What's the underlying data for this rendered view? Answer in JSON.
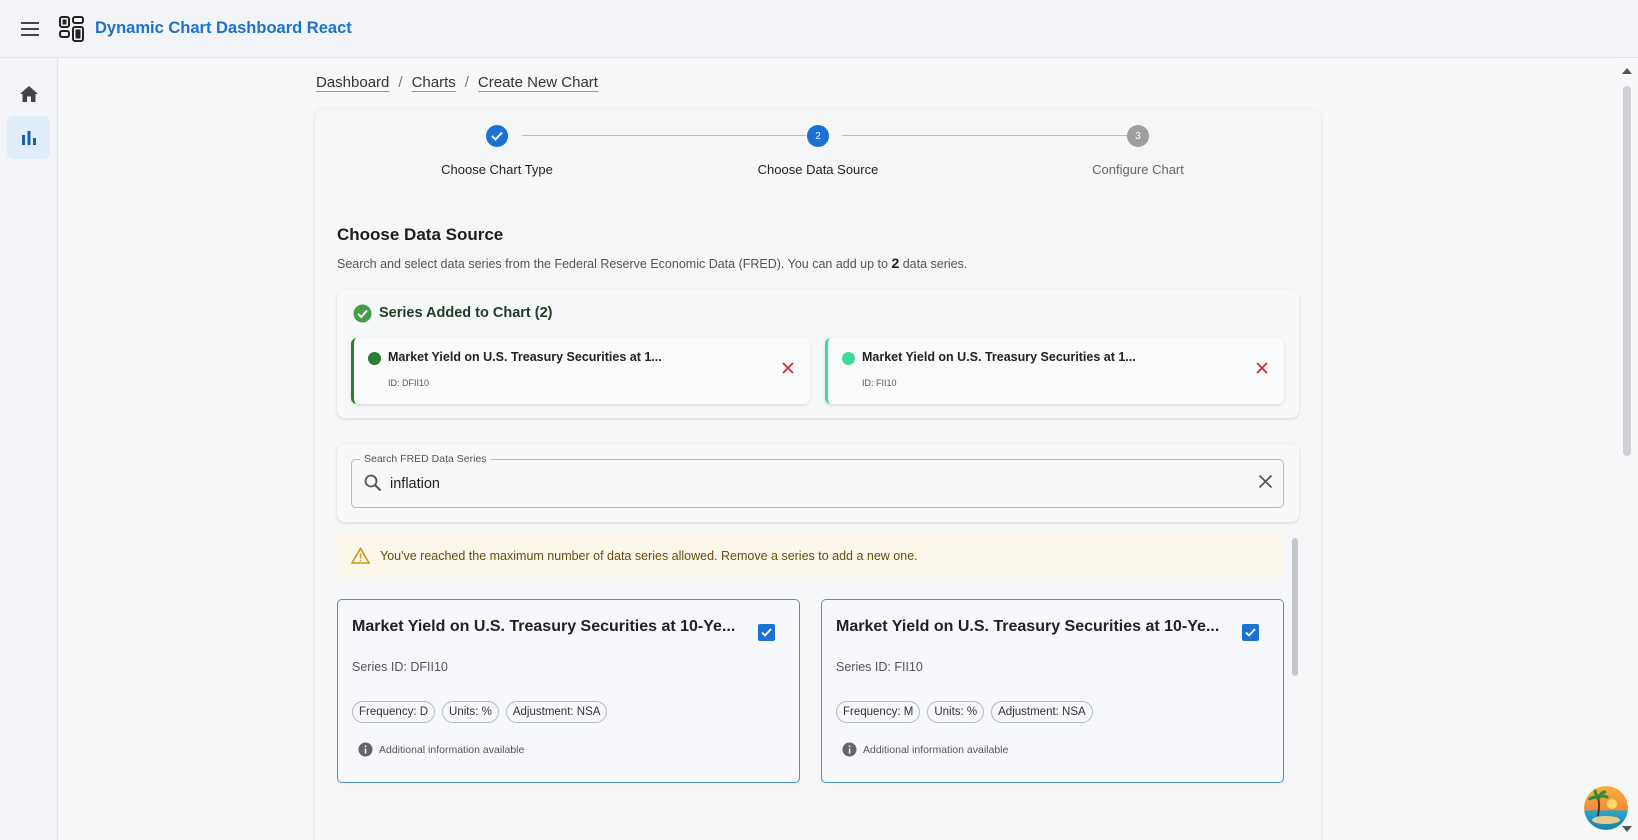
{
  "app": {
    "title": "Dynamic Chart Dashboard React"
  },
  "breadcrumb": [
    "Dashboard",
    "Charts",
    "Create New Chart"
  ],
  "steps": [
    {
      "label": "Choose Chart Type",
      "state": "completed"
    },
    {
      "label": "Choose Data Source",
      "number": "2",
      "state": "active"
    },
    {
      "label": "Configure Chart",
      "number": "3",
      "state": "pending"
    }
  ],
  "section": {
    "title": "Choose Data Source",
    "desc_prefix": "Search and select data series from the Federal Reserve Economic Data (FRED). You can add up to ",
    "desc_max": "2",
    "desc_suffix": " data series."
  },
  "added": {
    "title": "Series Added to Chart (2)",
    "items": [
      {
        "name": "Market Yield on U.S. Treasury Securities at 1...",
        "id": "ID: DFII10",
        "color": "#2e7d32"
      },
      {
        "name": "Market Yield on U.S. Treasury Securities at 1...",
        "id": "ID: FII10",
        "color": "#3ddc97"
      }
    ]
  },
  "search": {
    "label": "Search FRED Data Series",
    "value": "inflation"
  },
  "warning": "You've reached the maximum number of data series allowed. Remove a series to add a new one.",
  "results": [
    {
      "title": "Market Yield on U.S. Treasury Securities at 10-Ye...",
      "series_id": "Series ID: DFII10",
      "frequency": "Frequency: D",
      "units": "Units: %",
      "adjustment": "Adjustment: NSA",
      "info": "Additional information available",
      "checked": true
    },
    {
      "title": "Market Yield on U.S. Treasury Securities at 10-Ye...",
      "series_id": "Series ID: FII10",
      "frequency": "Frequency: M",
      "units": "Units: %",
      "adjustment": "Adjustment: NSA",
      "info": "Additional information available",
      "checked": true
    }
  ],
  "colors": {
    "primary": "#1b74c9",
    "success": "#43a047",
    "remove": "#d32f2f",
    "warning": "#b8860b"
  }
}
